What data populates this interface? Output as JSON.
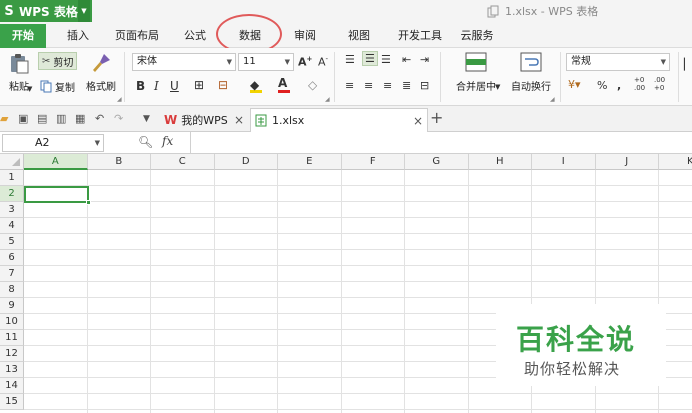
{
  "app": {
    "name": "WPS 表格",
    "logo": "S"
  },
  "window": {
    "title": "1.xlsx - WPS 表格"
  },
  "menu": {
    "tabs": [
      {
        "label": "开始",
        "active": true
      },
      {
        "label": "插入"
      },
      {
        "label": "页面布局"
      },
      {
        "label": "公式"
      },
      {
        "label": "数据"
      },
      {
        "label": "审阅"
      },
      {
        "label": "视图"
      },
      {
        "label": "开发工具"
      },
      {
        "label": "云服务"
      }
    ]
  },
  "ribbon": {
    "paste_label": "粘贴",
    "cut_label": "剪切",
    "copy_label": "复制",
    "format_painter_label": "格式刷",
    "font_name": "宋体",
    "font_size": "11",
    "bold": "B",
    "italic": "I",
    "underline": "U",
    "font_color_glyph": "A",
    "merge_label": "合并居中",
    "wrap_label": "自动换行",
    "number_format": "常规",
    "percent": "%",
    "comma": ",",
    "inc_decimal": "+0 .00",
    "dec_decimal": ".00 +0"
  },
  "doc_tabs": [
    {
      "label": "我的WPS",
      "active": false
    },
    {
      "label": "1.xlsx",
      "active": true
    }
  ],
  "new_tab_glyph": "+",
  "formula_bar": {
    "name_box": "A2",
    "fx_label": "fx",
    "value": ""
  },
  "sheet": {
    "columns": [
      "A",
      "B",
      "C",
      "D",
      "E",
      "F",
      "G",
      "H",
      "I",
      "J",
      "K"
    ],
    "rows": [
      "1",
      "2",
      "3",
      "4",
      "5",
      "6",
      "7",
      "8",
      "9",
      "10",
      "11",
      "12",
      "13",
      "14",
      "15"
    ],
    "selected_cell": "A2"
  },
  "watermark": {
    "title": "百科全说",
    "subtitle": "助你轻松解决"
  },
  "colors": {
    "accent": "#3a9a43",
    "annotation": "#e05a5a"
  }
}
